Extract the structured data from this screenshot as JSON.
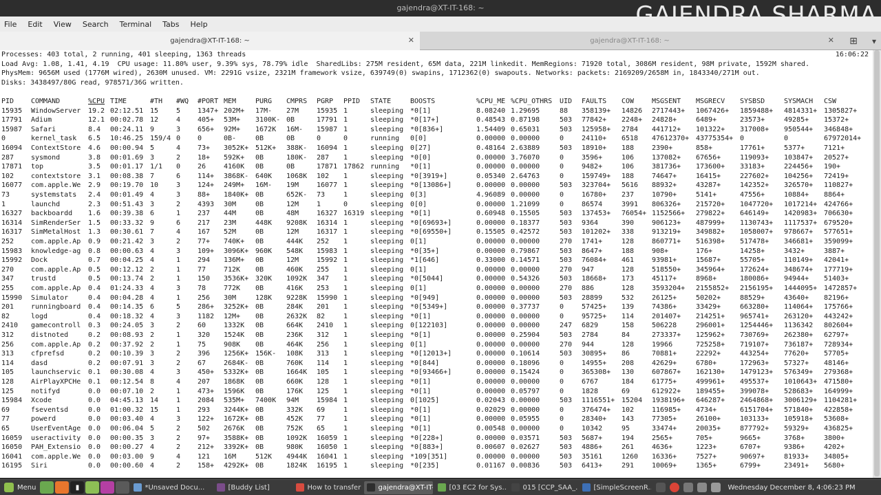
{
  "window": {
    "title": "gajendra@XT-IT-168: ~",
    "watermark": "GAJENDRA SHARMA"
  },
  "menubar": [
    "File",
    "Edit",
    "View",
    "Search",
    "Terminal",
    "Tabs",
    "Help"
  ],
  "tabs": [
    {
      "label": "gajendra@XT-IT-168: ~",
      "active": true
    },
    {
      "label": "gajendra@XT-IT-168: ~",
      "active": false
    }
  ],
  "summary": {
    "processes": "Processes: 403 total, 2 running, 401 sleeping, 1363 threads",
    "time": "16:06:22",
    "load": "Load Avg: 1.08, 1.41, 4.19  CPU usage: 11.80% user, 9.39% sys, 78.79% idle  SharedLibs: 275M resident, 65M data, 221M linkedit. MemRegions: 71920 total, 3086M resident, 98M private, 1592M shared.",
    "physmem": "PhysMem: 9656M used (1776M wired), 2630M unused. VM: 2291G vsize, 2321M framework vsize, 639749(0) swapins, 1712362(0) swapouts. Networks: packets: 2169209/2658M in, 1843340/271M out.",
    "disks": "Disks: 3438497/80G read, 978571/36G written."
  },
  "columns": [
    "PID",
    "COMMAND",
    "%CPU",
    "TIME",
    "#TH",
    "#WQ",
    "#PORT",
    "MEM",
    "PURG",
    "CMPRS",
    "PGRP",
    "PPID",
    "STATE",
    "BOOSTS",
    "%CPU_ME",
    "%CPU_OTHRS",
    "UID",
    "FAULTS",
    "COW",
    "MSGSENT",
    "MSGRECV",
    "SYSBSD",
    "SYSMACH",
    "CSW"
  ],
  "sort_column": "%CPU",
  "rows": [
    [
      "15935",
      "WindowServer",
      "19.2",
      "02:12.51",
      "15",
      "5",
      "1347+",
      "202M+",
      "17M-",
      "27M",
      "15935",
      "1",
      "sleeping",
      "*0[1]",
      "8.08240",
      "1.29695",
      "88",
      "358139+",
      "14826",
      "2717443+",
      "1067426+",
      "1859488+",
      "4814331+",
      "1305827+"
    ],
    [
      "17791",
      "Adium",
      "12.1",
      "00:02.78",
      "12",
      "4",
      "405+",
      "53M+",
      "3100K-",
      "0B",
      "17791",
      "1",
      "sleeping",
      "*0[17+]",
      "0.48543",
      "0.87198",
      "503",
      "77842+",
      "2248+",
      "24828+",
      "6489+",
      "23573+",
      "49285+",
      "15372+"
    ],
    [
      "15987",
      "Safari",
      "8.4",
      "00:24.11",
      "9",
      "3",
      "656+",
      "92M+",
      "1672K",
      "16M-",
      "15987",
      "1",
      "sleeping",
      "*0[836+]",
      "1.54409",
      "0.65031",
      "503",
      "125958+",
      "2784",
      "441712+",
      "101322+",
      "317008+",
      "950544+",
      "346848+"
    ],
    [
      "0",
      "kernel_task",
      "6.5",
      "10:46.25",
      "159/4",
      "0",
      "0",
      "0B-",
      "0B",
      "0B",
      "0",
      "0",
      "running",
      "0[0]",
      "0.00000",
      "0.00000",
      "0",
      "24110+",
      "6518",
      "47612370+",
      "43775354+",
      "0",
      "0",
      "67972014+"
    ],
    [
      "16094",
      "ContextStore",
      "4.6",
      "00:00.94",
      "5",
      "4",
      "73+",
      "3052K+",
      "512K+",
      "388K-",
      "16094",
      "1",
      "sleeping",
      "0[27]",
      "0.48164",
      "2.63889",
      "503",
      "18910+",
      "188",
      "2390+",
      "858+",
      "17761+",
      "5377+",
      "7121+"
    ],
    [
      "287",
      "sysmond",
      "3.8",
      "00:01.69",
      "3",
      "2",
      "18+",
      "592K+",
      "0B",
      "180K-",
      "287",
      "1",
      "sleeping",
      "*0[0]",
      "0.00000",
      "3.76070",
      "0",
      "3596+",
      "106",
      "137082+",
      "67656+",
      "119093+",
      "103847+",
      "20527+"
    ],
    [
      "17871",
      "top",
      "3.5",
      "00:01.17",
      "1/1",
      "0",
      "26",
      "4160K",
      "0B",
      "0B",
      "17871",
      "17862",
      "running",
      "*0[1]",
      "0.00000",
      "0.00000",
      "0",
      "9482+",
      "106",
      "381736+",
      "173600+",
      "33183+",
      "224456+",
      "190+"
    ],
    [
      "102",
      "contextstore",
      "3.1",
      "00:08.38",
      "7",
      "6",
      "114+",
      "3868K-",
      "640K",
      "1068K",
      "102",
      "1",
      "sleeping",
      "*0[3919+]",
      "0.05340",
      "2.64763",
      "0",
      "159749+",
      "188",
      "74647+",
      "16415+",
      "227602+",
      "104256+",
      "72419+"
    ],
    [
      "16077",
      "com.apple.We",
      "2.9",
      "00:19.70",
      "10",
      "3",
      "124+",
      "249M+",
      "16M-",
      "19M",
      "16077",
      "1",
      "sleeping",
      "*0[13086+]",
      "0.00000",
      "0.00000",
      "503",
      "323704+",
      "5616",
      "88932+",
      "43287+",
      "142352+",
      "326570+",
      "110827+"
    ],
    [
      "73",
      "systemstats",
      "2.4",
      "00:01.49",
      "4",
      "3",
      "88+",
      "1840K+",
      "0B",
      "652K-",
      "73",
      "1",
      "sleeping",
      "0[3]",
      "4.96089",
      "0.00000",
      "0",
      "16780+",
      "237",
      "10790+",
      "5141+",
      "47556+",
      "10884+",
      "8864+"
    ],
    [
      "1",
      "launchd",
      "2.3",
      "00:51.43",
      "3",
      "2",
      "4393",
      "30M",
      "0B",
      "12M",
      "1",
      "0",
      "sleeping",
      "0[0]",
      "0.00000",
      "1.21099",
      "0",
      "86574",
      "3991",
      "806326+",
      "215720+",
      "1047720+",
      "1017214+",
      "424766+"
    ],
    [
      "16327",
      "backboardd",
      "1.6",
      "00:39.38",
      "6",
      "1",
      "237",
      "44M",
      "0B",
      "48M",
      "16327",
      "16319",
      "sleeping",
      "*0[1]",
      "0.60948",
      "0.15505",
      "503",
      "137453+",
      "76054+",
      "1152566+",
      "279822+",
      "646149+",
      "1420983+",
      "706630+"
    ],
    [
      "16314",
      "SimRenderSer",
      "1.5",
      "00:33.32",
      "9",
      "6",
      "217",
      "23M",
      "448K",
      "9208K",
      "16314",
      "1",
      "sleeping",
      "*0[69693+]",
      "0.00000",
      "0.18377",
      "503",
      "9364",
      "390",
      "906123+",
      "487999+",
      "1130743+",
      "1117537+",
      "679520+"
    ],
    [
      "16317",
      "SimMetalHost",
      "1.3",
      "00:30.61",
      "7",
      "4",
      "167",
      "52M",
      "0B",
      "12M",
      "16317",
      "1",
      "sleeping",
      "*0[69550+]",
      "0.15505",
      "0.42572",
      "503",
      "101202+",
      "338",
      "913219+",
      "349882+",
      "1058007+",
      "978667+",
      "577651+"
    ],
    [
      "252",
      "com.apple.Ap",
      "0.9",
      "00:21.42",
      "3",
      "2",
      "77+",
      "740K+",
      "0B",
      "444K",
      "252",
      "1",
      "sleeping",
      "0[1]",
      "0.00000",
      "0.00000",
      "270",
      "1741+",
      "128",
      "860771+",
      "516398+",
      "517478+",
      "346681+",
      "359099+"
    ],
    [
      "15983",
      "knowledge-ag",
      "0.8",
      "00:00.63",
      "4",
      "3",
      "109+",
      "3096K+",
      "960K",
      "548K",
      "15983",
      "1",
      "sleeping",
      "*0[35+]",
      "0.00000",
      "0.79867",
      "503",
      "8647+",
      "188",
      "908+",
      "176+",
      "14258+",
      "3432+",
      "3887+"
    ],
    [
      "15992",
      "Dock",
      "0.7",
      "00:04.25",
      "4",
      "1",
      "294",
      "136M+",
      "0B",
      "12M",
      "15992",
      "1",
      "sleeping",
      "*1[646]",
      "0.33000",
      "0.14571",
      "503",
      "76084+",
      "461",
      "93981+",
      "15687+",
      "55705+",
      "110149+",
      "42041+"
    ],
    [
      "270",
      "com.apple.Ap",
      "0.5",
      "00:12.12",
      "2",
      "1",
      "77",
      "712K",
      "0B",
      "460K",
      "255",
      "1",
      "sleeping",
      "0[1]",
      "0.00000",
      "0.00000",
      "270",
      "947",
      "128",
      "518550+",
      "345964+",
      "172624+",
      "348674+",
      "177719+"
    ],
    [
      "347",
      "trustd",
      "0.5",
      "00:13.74",
      "2",
      "1",
      "150",
      "3536K+",
      "320K",
      "1092K",
      "347",
      "1",
      "sleeping",
      "*0[5044]",
      "0.00000",
      "0.54326",
      "503",
      "18668+",
      "173",
      "45117+",
      "8968+",
      "180086+",
      "94944+",
      "51403+"
    ],
    [
      "255",
      "com.apple.Ap",
      "0.4",
      "01:24.33",
      "4",
      "3",
      "78",
      "772K",
      "0B",
      "416K",
      "253",
      "1",
      "sleeping",
      "0[1]",
      "0.00000",
      "0.00000",
      "270",
      "886",
      "128",
      "3593204+",
      "2155852+",
      "2156195+",
      "1444095+",
      "1472857+"
    ],
    [
      "15990",
      "Simulator",
      "0.4",
      "00:04.28",
      "4",
      "1",
      "256",
      "30M",
      "128K",
      "9228K",
      "15990",
      "1",
      "sleeping",
      "*0[949]",
      "0.00000",
      "0.00000",
      "503",
      "28899",
      "532",
      "26125+",
      "50202+",
      "88529+",
      "43640+",
      "82196+"
    ],
    [
      "201",
      "runningboard",
      "0.4",
      "00:14.35",
      "6",
      "5",
      "286+",
      "3252K+",
      "0B",
      "284K",
      "201",
      "1",
      "sleeping",
      "*0[5349+]",
      "0.00000",
      "0.37737",
      "0",
      "57425+",
      "139",
      "74386+",
      "33429+",
      "663280+",
      "114064+",
      "175766+"
    ],
    [
      "82",
      "logd",
      "0.4",
      "00:18.32",
      "4",
      "3",
      "1182",
      "12M+",
      "0B",
      "2632K",
      "82",
      "1",
      "sleeping",
      "*0[1]",
      "0.00000",
      "0.00000",
      "0",
      "95725+",
      "114",
      "201407+",
      "214251+",
      "965741+",
      "263120+",
      "443242+"
    ],
    [
      "2410",
      "gamecontroll",
      "0.3",
      "00:24.05",
      "3",
      "2",
      "60",
      "1332K",
      "0B",
      "664K",
      "2410",
      "1",
      "sleeping",
      "0[122103]",
      "0.00000",
      "0.00000",
      "247",
      "6829",
      "158",
      "506228",
      "296001+",
      "1254446+",
      "1136342",
      "802604+"
    ],
    [
      "312",
      "distnoted",
      "0.2",
      "00:08.93",
      "2",
      "1",
      "320",
      "1524K",
      "0B",
      "236K",
      "312",
      "1",
      "sleeping",
      "*0[1]",
      "0.00000",
      "0.25904",
      "503",
      "2784",
      "84",
      "273337+",
      "125962+",
      "730769+",
      "262380+",
      "62797+"
    ],
    [
      "256",
      "com.apple.Ap",
      "0.2",
      "00:37.92",
      "2",
      "1",
      "75",
      "908K",
      "0B",
      "464K",
      "256",
      "1",
      "sleeping",
      "0[1]",
      "0.00000",
      "0.00000",
      "270",
      "944",
      "128",
      "19966",
      "725258+",
      "719107+",
      "736187+",
      "728934+"
    ],
    [
      "313",
      "cfprefsd",
      "0.2",
      "00:10.39",
      "3",
      "2",
      "396",
      "1256K+",
      "156K-",
      "108K",
      "313",
      "1",
      "sleeping",
      "*0[12013+]",
      "0.00000",
      "0.10614",
      "503",
      "30895+",
      "86",
      "70881+",
      "22292+",
      "443254+",
      "77620+",
      "57705+"
    ],
    [
      "114",
      "dasd",
      "0.2",
      "00:07.91",
      "3",
      "2",
      "67",
      "2684K-",
      "0B",
      "760K",
      "114",
      "1",
      "sleeping",
      "*0[844]",
      "0.00000",
      "0.18096",
      "0",
      "14955+",
      "208",
      "42629+",
      "6780+",
      "172963+",
      "57327+",
      "48146+"
    ],
    [
      "105",
      "launchservic",
      "0.1",
      "00:30.08",
      "4",
      "3",
      "450+",
      "5332K+",
      "0B",
      "1664K",
      "105",
      "1",
      "sleeping",
      "*0[93466+]",
      "0.00000",
      "0.15424",
      "0",
      "365308+",
      "130",
      "607867+",
      "162130+",
      "1479123+",
      "576349+",
      "279368+"
    ],
    [
      "128",
      "AirPlayXPCHe",
      "0.1",
      "00:12.54",
      "8",
      "4",
      "207",
      "1868K",
      "0B",
      "660K",
      "128",
      "1",
      "sleeping",
      "*0[1]",
      "0.00000",
      "0.00000",
      "0",
      "6767",
      "184",
      "61775+",
      "499961+",
      "495537+",
      "1010643+",
      "471580+"
    ],
    [
      "125",
      "notifyd",
      "0.0",
      "00:07.10",
      "2",
      "1",
      "473+",
      "1596K",
      "0B",
      "176K",
      "125",
      "1",
      "sleeping",
      "*0[1]",
      "0.00000",
      "0.05797",
      "0",
      "1828",
      "69",
      "612922+",
      "189455+",
      "399078+",
      "528683+",
      "164999+"
    ],
    [
      "15984",
      "Xcode",
      "0.0",
      "04:45.13",
      "14",
      "1",
      "2084",
      "535M+",
      "7400K",
      "94M",
      "15984",
      "1",
      "sleeping",
      "0[1025]",
      "0.02043",
      "0.00000",
      "503",
      "1116551+",
      "15204",
      "1938196+",
      "646287+",
      "2464868+",
      "3006129+",
      "1104281+"
    ],
    [
      "69",
      "fseventsd",
      "0.0",
      "01:00.32",
      "15",
      "1",
      "293",
      "3244K+",
      "0B",
      "332K",
      "69",
      "1",
      "sleeping",
      "*0[1]",
      "0.02029",
      "0.00000",
      "0",
      "376474+",
      "102",
      "116985+",
      "4734+",
      "6151704+",
      "571840+",
      "422858+"
    ],
    [
      "77",
      "powerd",
      "0.0",
      "00:03.40",
      "4",
      "3",
      "122+",
      "1672K+",
      "0B",
      "452K",
      "77",
      "1",
      "sleeping",
      "*0[1]",
      "0.00000",
      "0.05955",
      "0",
      "28340+",
      "143",
      "77305+",
      "26100+",
      "103133+",
      "105918+",
      "53608+"
    ],
    [
      "65",
      "UserEventAge",
      "0.0",
      "00:06.04",
      "5",
      "2",
      "502",
      "2676K",
      "0B",
      "752K",
      "65",
      "1",
      "sleeping",
      "*0[1]",
      "0.00548",
      "0.00000",
      "0",
      "10342",
      "95",
      "33474+",
      "20035+",
      "877792+",
      "59329+",
      "436825+"
    ],
    [
      "16059",
      "useractivity",
      "0.0",
      "00:00.35",
      "3",
      "2",
      "97+",
      "3588K+",
      "0B",
      "1092K",
      "16059",
      "1",
      "sleeping",
      "*0[228+]",
      "0.00000",
      "0.03571",
      "503",
      "5687+",
      "194",
      "2565+",
      "705+",
      "9665+",
      "3768+",
      "3800+"
    ],
    [
      "16050",
      "PAH_Extensio",
      "0.0",
      "00:00.27",
      "4",
      "2",
      "212+",
      "3392K+",
      "0B",
      "980K",
      "16050",
      "1",
      "sleeping",
      "*0[883+]",
      "0.00607",
      "0.02627",
      "503",
      "4886+",
      "261",
      "4636+",
      "1223+",
      "6707+",
      "9386+",
      "4202+"
    ],
    [
      "16041",
      "com.apple.We",
      "0.0",
      "00:03.00",
      "9",
      "4",
      "121",
      "16M",
      "512K",
      "4944K",
      "16041",
      "1",
      "sleeping",
      "*109[351]",
      "0.00000",
      "0.00000",
      "503",
      "35161",
      "1260",
      "16336+",
      "7527+",
      "90697+",
      "81933+",
      "34805+"
    ],
    [
      "16195",
      "Siri",
      "0.0",
      "00:00.60",
      "4",
      "2",
      "158+",
      "4292K+",
      "0B",
      "1824K",
      "16195",
      "1",
      "sleeping",
      "*0[235]",
      "0.01167",
      "0.00836",
      "503",
      "6413+",
      "291",
      "10069+",
      "1365+",
      "6799+",
      "23491+",
      "5680+"
    ]
  ],
  "taskbar": {
    "menu_label": "Menu",
    "windows": [
      {
        "label": "*Unsaved Docu...",
        "icon_color": "#6a9bd1",
        "active": false
      },
      {
        "label": "[Buddy List]",
        "icon_color": "#7a4c8a",
        "active": false
      },
      {
        "label": "How to transfer ...",
        "icon_color": "#d74b3f",
        "active": false
      },
      {
        "label": "gajendra@XT-IT-...",
        "icon_color": "#2e2e2e",
        "active": true
      },
      {
        "label": "[03 EC2 for Sys...",
        "icon_color": "#6aa84f",
        "active": false
      },
      {
        "label": "015 [CCP_SAA_...",
        "icon_color": "#444444",
        "active": false
      },
      {
        "label": "[SimpleScreenR...",
        "icon_color": "#3d6fb5",
        "active": false
      }
    ],
    "clock": "Wednesday December 8, 4:06:23 PM"
  }
}
